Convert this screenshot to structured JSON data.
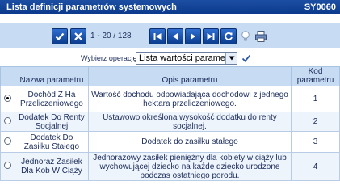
{
  "window": {
    "title": "Lista definicji parametrów systemowych",
    "code": "SY0060"
  },
  "toolbar": {
    "accept_icon": "check-icon",
    "cancel_icon": "x-icon",
    "counter": "1 - 20 / 128",
    "first_icon": "first-page-icon",
    "prev_icon": "prev-page-icon",
    "next_icon": "next-page-icon",
    "last_icon": "last-page-icon",
    "refresh_icon": "refresh-icon",
    "hint_icon": "lightbulb-icon",
    "print_icon": "print-icon"
  },
  "operation": {
    "label": "Wybierz operację:",
    "selected": "Lista wartości parametru"
  },
  "table": {
    "headers": {
      "name": "Nazwa parametru",
      "desc": "Opis parametru",
      "code": "Kod parametru"
    },
    "rows": [
      {
        "selected": true,
        "name": "Dochód Z Ha Przeliczeniowego",
        "desc": "Wartość dochodu odpowiadająca dochodowi z jednego hektara przeliczeniowego.",
        "code": "1"
      },
      {
        "selected": false,
        "name": "Dodatek Do Renty Socjalnej",
        "desc": "Ustawowo określona wysokość dodatku do renty socjalnej.",
        "code": "2"
      },
      {
        "selected": false,
        "name": "Dodatek Do Zasiłku Stałego",
        "desc": "Dodatek do zasiłku stałego",
        "code": "3"
      },
      {
        "selected": false,
        "name": "Jednoraz Zasiłek Dla Kob W Ciąży",
        "desc": "Jednorazowy zasiłek pieniężny dla kobiety w ciąży lub wychowującej dziecko na każde dziecko urodzone podczas ostatniego porodu.",
        "code": "4"
      }
    ]
  },
  "colors": {
    "titlebar": "#0c3a8c",
    "toolbar_bg": "#c7dbf2",
    "button": "#1f5cbf",
    "row_alt": "#eef4fb"
  }
}
